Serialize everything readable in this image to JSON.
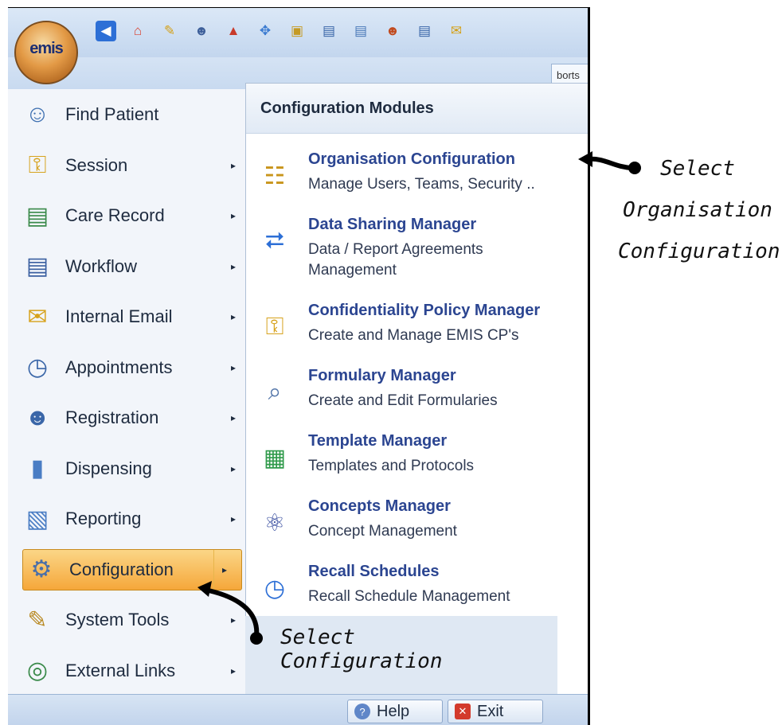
{
  "app": {
    "logo_text": "emis"
  },
  "toolbar": {
    "icons": [
      "back-icon",
      "home-icon",
      "pencil-icon",
      "user-search-icon",
      "chart-icon",
      "compass-icon",
      "folder-icon",
      "calendar-icon",
      "document-icon",
      "users-icon",
      "notes-icon",
      "email-icon"
    ],
    "reports_tab": "borts"
  },
  "menu": {
    "items": [
      {
        "label": "Find Patient",
        "icon": "find-patient-icon",
        "has_submenu": false
      },
      {
        "label": "Session",
        "icon": "key-icon",
        "has_submenu": true
      },
      {
        "label": "Care Record",
        "icon": "care-record-icon",
        "has_submenu": true
      },
      {
        "label": "Workflow",
        "icon": "clipboard-icon",
        "has_submenu": true
      },
      {
        "label": "Internal Email",
        "icon": "envelope-icon",
        "has_submenu": true
      },
      {
        "label": "Appointments",
        "icon": "calendar-clock-icon",
        "has_submenu": true
      },
      {
        "label": "Registration",
        "icon": "person-icon",
        "has_submenu": true
      },
      {
        "label": "Dispensing",
        "icon": "bottle-icon",
        "has_submenu": true
      },
      {
        "label": "Reporting",
        "icon": "report-icon",
        "has_submenu": true
      },
      {
        "label": "Configuration",
        "icon": "gear-magnifier-icon",
        "has_submenu": true,
        "active": true
      },
      {
        "label": "System Tools",
        "icon": "pencil-icon",
        "has_submenu": true
      },
      {
        "label": "External Links",
        "icon": "globe-icon",
        "has_submenu": true
      }
    ]
  },
  "submenu": {
    "title": "Configuration Modules",
    "items": [
      {
        "title": "Organisation Configuration",
        "desc": "Manage Users, Teams, Security ..",
        "icon": "org-chart-icon"
      },
      {
        "title": "Data Sharing Manager",
        "desc": "Data / Report Agreements Management",
        "icon": "share-icon"
      },
      {
        "title": "Confidentiality Policy Manager",
        "desc": "Create and Manage EMIS CP's",
        "icon": "lock-icon"
      },
      {
        "title": "Formulary Manager",
        "desc": "Create and Edit Formularies",
        "icon": "search-icon"
      },
      {
        "title": "Template Manager",
        "desc": "Templates and Protocols",
        "icon": "grid-icon"
      },
      {
        "title": "Concepts Manager",
        "desc": "Concept Management",
        "icon": "atom-icon"
      },
      {
        "title": "Recall Schedules",
        "desc": "Recall Schedule Management",
        "icon": "clock-icon"
      }
    ]
  },
  "bottom": {
    "help_label": "Help",
    "exit_label": "Exit"
  },
  "annotations": {
    "org_config_note_1": "Select",
    "org_config_note_2": "Organisation",
    "org_config_note_3": "Configuration",
    "config_note": "Select Configuration"
  },
  "colors": {
    "accent": "#2b4591",
    "active_menu": "#f5a73a"
  }
}
